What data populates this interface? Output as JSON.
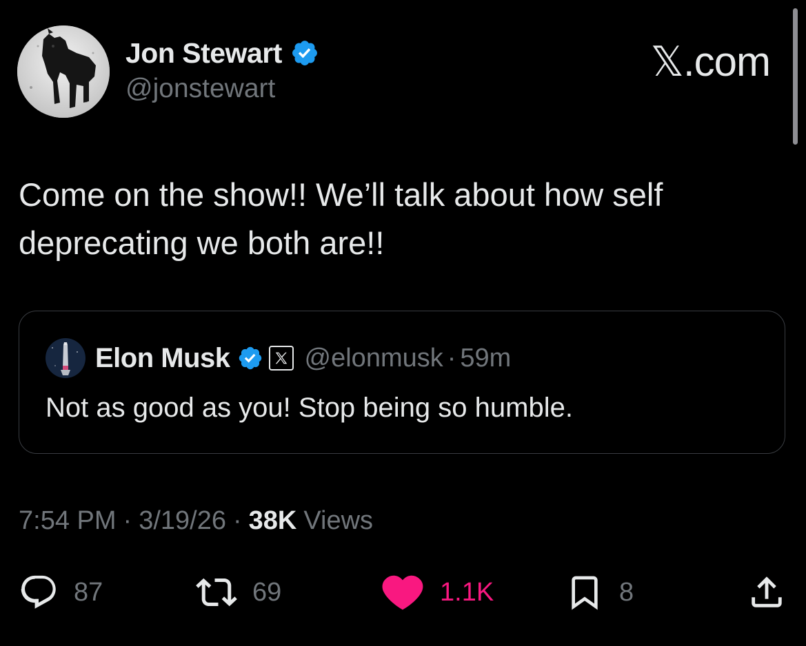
{
  "site": {
    "label": "𝕏.com"
  },
  "tweet": {
    "author_name": "Jon Stewart",
    "author_handle": "@jonstewart",
    "text": "Come on the show!! We’ll talk about how self deprecating we both are!!",
    "time": "7:54 PM",
    "date": "3/19/26",
    "views_count": "38K",
    "views_label": "Views",
    "separator": "·"
  },
  "quote": {
    "author_name": "Elon Musk",
    "handle": "@elonmusk",
    "separator": "·",
    "time": "59m",
    "text": "Not as good as you! Stop being so humble."
  },
  "actions": {
    "replies": "87",
    "reposts": "69",
    "likes": "1.1K",
    "bookmarks": "8"
  },
  "colors": {
    "background": "#000000",
    "text_primary": "#e7e9ea",
    "text_secondary": "#71767b",
    "verified_blue": "#1d9bf0",
    "like_pink": "#f91880",
    "card_border": "#3a3d42"
  },
  "icons": {
    "verified": "verified-badge-icon",
    "affiliate": "x-logo-icon",
    "reply": "reply-icon",
    "repost": "repost-icon",
    "like": "heart-icon",
    "bookmark": "bookmark-icon",
    "share": "share-icon"
  }
}
